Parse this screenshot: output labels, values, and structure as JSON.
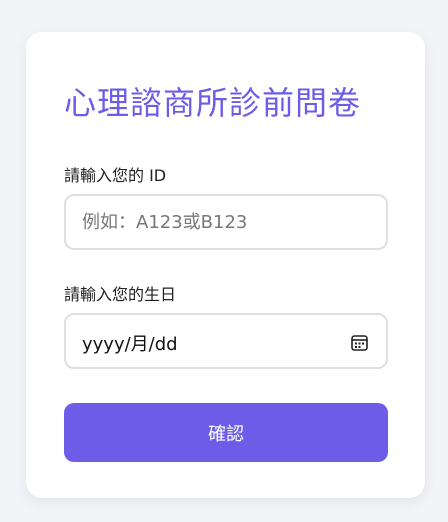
{
  "form": {
    "title": "心理諮商所診前問卷",
    "id_label": "請輸入您的 ID",
    "id_placeholder": "例如：A123或B123",
    "birthday_label": "請輸入您的生日",
    "birthday_format": "yyyy/月/dd",
    "confirm_label": "確認"
  },
  "icons": {
    "date_picker": "calendar-icon"
  },
  "colors": {
    "accent": "#6c5ce7",
    "background": "#f3f4f8",
    "card": "#ffffff",
    "border": "#dcdfe4"
  }
}
